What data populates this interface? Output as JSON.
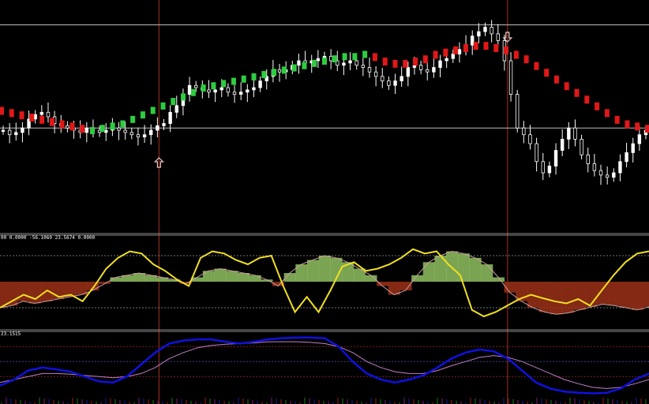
{
  "chart_data": {
    "type": "line",
    "colors": {
      "background": "#000000",
      "candle_body": "#ffffff",
      "trend_up": "#2ecc40",
      "trend_down": "#e01818",
      "oscillator_line": "#f0e020",
      "histogram_up": "#8fbf60",
      "histogram_down": "#9a3018",
      "signal_line": "#c8a0a0",
      "fast_line": "#1010e0",
      "slow_line": "#c080c8",
      "separator": "#8a8a8a",
      "marker_line": "#8b2a1a",
      "arrow": "#f0c8c8"
    },
    "price_panel": {
      "ylim": [
        0,
        100
      ],
      "hlines": [
        91,
        45
      ],
      "close": [
        44,
        42,
        43,
        45,
        49,
        51,
        52,
        50,
        47,
        46,
        45,
        44,
        43,
        45,
        44,
        43,
        44,
        45,
        44,
        43,
        42,
        41,
        42,
        44,
        46,
        47,
        52,
        55,
        60,
        64,
        63,
        62,
        61,
        62,
        63,
        61,
        60,
        61,
        62,
        63,
        66,
        68,
        71,
        70,
        71,
        73,
        75,
        74,
        75,
        76,
        77,
        75,
        73,
        74,
        75,
        73,
        72,
        70,
        68,
        66,
        64,
        66,
        68,
        72,
        73,
        71,
        70,
        72,
        75,
        76,
        78,
        80,
        82,
        86,
        88,
        90,
        87,
        84,
        75,
        60,
        45,
        42,
        38,
        30,
        25,
        28,
        35,
        40,
        45,
        40,
        33,
        29,
        26,
        24,
        23,
        25,
        30,
        34,
        38,
        42,
        44
      ],
      "trend": [
        53,
        52,
        51,
        50,
        49,
        48,
        47,
        46,
        45,
        44,
        45,
        46,
        47,
        49,
        51,
        53,
        55,
        57,
        59,
        61,
        63,
        64,
        65,
        66,
        67,
        68,
        69,
        70,
        71,
        72,
        73,
        74,
        75,
        76,
        77,
        77,
        78,
        77,
        75,
        74,
        74,
        75,
        76,
        78,
        79,
        80,
        81,
        82,
        82,
        81,
        80,
        78,
        76,
        73,
        70,
        67,
        64,
        61,
        58,
        55,
        52,
        49,
        47,
        46,
        45
      ],
      "trend_up_from": 9,
      "trend_up_to": 36
    },
    "oscillator_panel": {
      "label": "00  0.0000  -56.1060  23.5674  0.0000",
      "ylim": [
        -100,
        100
      ],
      "zero_line": 0,
      "levels": [
        60,
        -60
      ],
      "histogram": [
        -60,
        -55,
        -45,
        -50,
        -45,
        -40,
        -35,
        -30,
        -20,
        -5,
        10,
        15,
        20,
        15,
        10,
        5,
        -5,
        10,
        25,
        30,
        25,
        20,
        15,
        5,
        -10,
        20,
        40,
        50,
        60,
        55,
        45,
        30,
        15,
        -10,
        -30,
        -20,
        15,
        45,
        60,
        70,
        65,
        55,
        40,
        10,
        -25,
        -45,
        -60,
        -70,
        -75,
        -72,
        -65,
        -58,
        -52,
        -55,
        -60,
        -65,
        -58
      ],
      "oscillator": [
        -60,
        -45,
        -30,
        -40,
        -20,
        -35,
        -30,
        -45,
        -10,
        30,
        55,
        70,
        65,
        40,
        25,
        5,
        -10,
        55,
        70,
        65,
        50,
        40,
        55,
        60,
        -10,
        -70,
        -35,
        -70,
        -20,
        35,
        45,
        25,
        30,
        40,
        55,
        75,
        65,
        70,
        40,
        15,
        -65,
        -80,
        -70,
        -55,
        -40,
        -30,
        -38,
        -45,
        -50,
        -40,
        -55,
        -20,
        15,
        45,
        65,
        70
      ]
    },
    "stoch_panel": {
      "label": "23.1515",
      "ylim": [
        0,
        100
      ],
      "levels": [
        80,
        55,
        30
      ],
      "fast": [
        15,
        25,
        40,
        45,
        42,
        38,
        30,
        22,
        20,
        30,
        50,
        70,
        85,
        90,
        92,
        92,
        88,
        85,
        88,
        92,
        94,
        95,
        95,
        94,
        80,
        55,
        35,
        25,
        20,
        25,
        32,
        45,
        60,
        70,
        75,
        72,
        60,
        40,
        20,
        10,
        5,
        3,
        2,
        3,
        10,
        25,
        35
      ],
      "slow": [
        20,
        25,
        30,
        35,
        35,
        34,
        32,
        30,
        28,
        30,
        35,
        45,
        60,
        70,
        78,
        82,
        84,
        85,
        86,
        88,
        88,
        88,
        87,
        85,
        80,
        70,
        55,
        45,
        38,
        35,
        35,
        40,
        48,
        55,
        62,
        65,
        62,
        55,
        45,
        35,
        25,
        18,
        12,
        10,
        12,
        18,
        25
      ]
    },
    "signals": [
      {
        "position": 0.245,
        "direction": "up"
      },
      {
        "position": 0.782,
        "direction": "down"
      }
    ]
  }
}
